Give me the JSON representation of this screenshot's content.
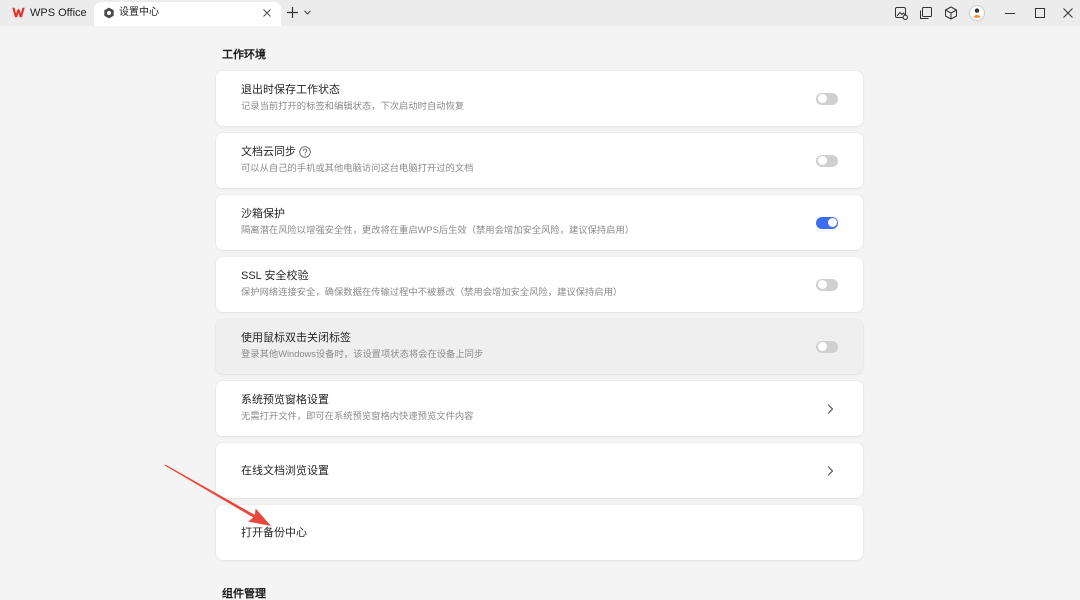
{
  "titlebar": {
    "tabs": [
      {
        "label": "WPS Office",
        "icon": "wps-logo-icon",
        "active": false
      },
      {
        "label": "设置中心",
        "icon": "gear-icon",
        "active": true,
        "close_icon": "close-icon"
      }
    ],
    "actions": [
      "plus-icon",
      "chevron-down-icon"
    ],
    "tools": [
      "image-edit-icon",
      "multi-window-icon",
      "cube-icon",
      "avatar-icon"
    ],
    "window_controls": [
      "minimize-icon",
      "maximize-icon",
      "close-icon"
    ]
  },
  "sections": [
    {
      "heading": "工作环境",
      "items": [
        {
          "title": "退出时保存工作状态",
          "desc": "记录当前打开的标签和编辑状态，下次启动时自动恢复",
          "toggle_on": false
        },
        {
          "title": "文档云同步",
          "help_icon": "question-circle-icon",
          "desc": "可以从自己的手机或其他电脑访问这台电脑打开过的文档",
          "toggle_on": false
        },
        {
          "title": "沙箱保护",
          "desc": "隔离潜在风险以增强安全性，更改将在重启WPS后生效（禁用会增加安全风险，建议保持启用）",
          "toggle_on": true
        },
        {
          "title": "SSL 安全校验",
          "desc": "保护网络连接安全，确保数据在传输过程中不被篡改（禁用会增加安全风险，建议保持启用）",
          "toggle_on": false
        },
        {
          "title": "使用鼠标双击关闭标签",
          "desc": "登录其他Windows设备时，该设置项状态将会在设备上同步",
          "toggle_on": false,
          "hovered": true
        },
        {
          "title": "系统预览窗格设置",
          "desc": "无需打开文件，即可在系统预览窗格内快速预览文件内容",
          "icon": "chevron-right-icon"
        },
        {
          "title": "在线文档浏览设置",
          "icon": "chevron-right-icon"
        },
        {
          "title": "打开备份中心"
        }
      ]
    },
    {
      "heading": "组件管理"
    }
  ],
  "annotation": {
    "icon": "red-arrow-icon",
    "color": "#e8473d"
  },
  "colors": {
    "accent": "#3a6cf4",
    "annotation": "#e8473d",
    "toggle_off": "#d0d0d0",
    "logo_red": "#e5322d"
  }
}
